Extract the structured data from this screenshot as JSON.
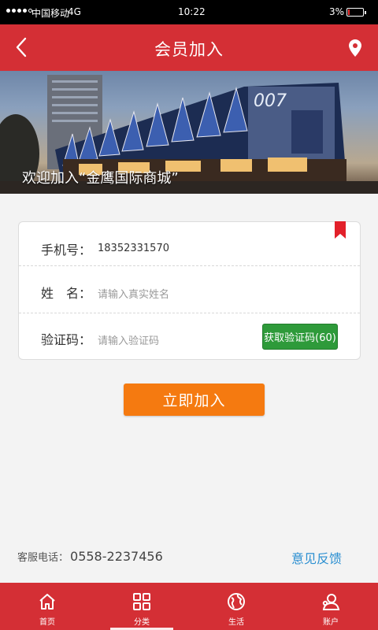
{
  "status_bar": {
    "carrier": "中国移动",
    "network": "4G",
    "time": "10:22",
    "battery": "3%"
  },
  "header": {
    "title": "会员加入",
    "back_icon": "chevron-left-icon",
    "location_icon": "location-pin-icon"
  },
  "banner": {
    "caption": "欢迎加入“金鹰国际商城”"
  },
  "form": {
    "phone_label": "手机号：",
    "phone_value": "18352331570",
    "name_label": "姓　名：",
    "name_placeholder": "请输入真实姓名",
    "code_label": "验证码：",
    "code_placeholder": "请输入验证码",
    "get_code_button": "获取验证码(60)"
  },
  "join_button": "立即加入",
  "footer": {
    "hotline_label": "客服电话：",
    "hotline_number": "0558-2237456",
    "feedback_link": "意见反馈"
  },
  "nav": {
    "items": [
      {
        "label": "首页",
        "icon": "home-icon"
      },
      {
        "label": "分类",
        "icon": "grid-icon"
      },
      {
        "label": "生活",
        "icon": "globe-icon"
      },
      {
        "label": "账户",
        "icon": "user-icon"
      }
    ],
    "active_index": 1
  },
  "colors": {
    "brand_red": "#d42f35",
    "action_orange": "#f57a10",
    "code_green": "#2e9a3a",
    "link_blue": "#2b8fd1"
  }
}
